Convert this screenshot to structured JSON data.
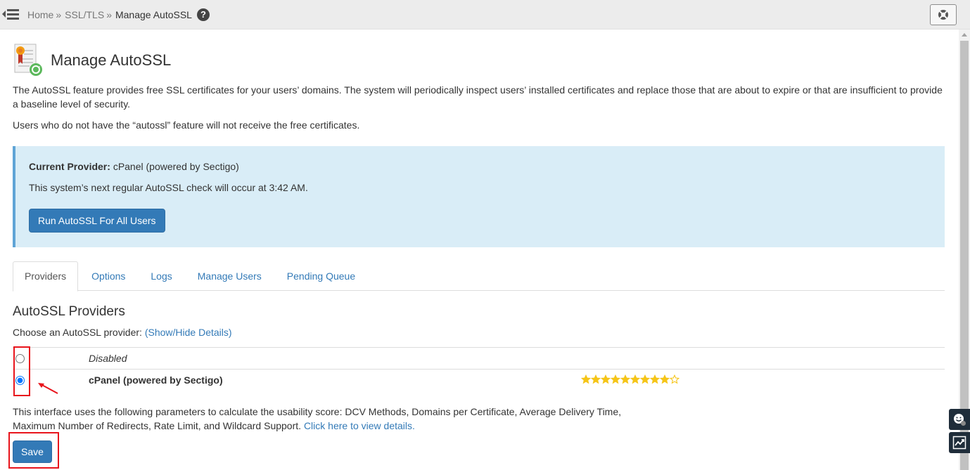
{
  "breadcrumb": {
    "home": "Home",
    "separator": "»",
    "ssl": "SSL/TLS",
    "current": "Manage AutoSSL"
  },
  "page": {
    "title": "Manage AutoSSL",
    "description1": "The AutoSSL feature provides free SSL certificates for your users’ domains. The system will periodically inspect users’ installed certificates and replace those that are about to expire or that are insufficient to provide a baseline level of security.",
    "description2": "Users who do not have the “autossl” feature will not receive the free certificates."
  },
  "info": {
    "provider_label": "Current Provider:",
    "provider_value": "cPanel (powered by Sectigo)",
    "next_check": "This system’s next regular AutoSSL check will occur at 3:42 AM.",
    "run_button": "Run AutoSSL For All Users"
  },
  "tabs": [
    {
      "label": "Providers",
      "active": true
    },
    {
      "label": "Options",
      "active": false
    },
    {
      "label": "Logs",
      "active": false
    },
    {
      "label": "Manage Users",
      "active": false
    },
    {
      "label": "Pending Queue",
      "active": false
    }
  ],
  "providers_section": {
    "title": "AutoSSL Providers",
    "choose_label": "Choose an AutoSSL provider:",
    "toggle_link": "(Show/Hide Details)",
    "rows": [
      {
        "name": "Disabled",
        "selected": false
      },
      {
        "name": "cPanel (powered by Sectigo)",
        "selected": true,
        "rating": 9,
        "rating_max": 10
      }
    ],
    "footnote": "This interface uses the following parameters to calculate the usability score: DCV Methods, Domains per Certificate, Average Delivery Time, Maximum Number of Redirects, Rate Limit, and Wildcard Support.",
    "footnote_link": "Click here to view details.",
    "save_button": "Save"
  },
  "colors": {
    "accent": "#337ab7",
    "info_bg": "#d9edf7",
    "star": "#f5c518",
    "highlight": "#e8141c"
  }
}
